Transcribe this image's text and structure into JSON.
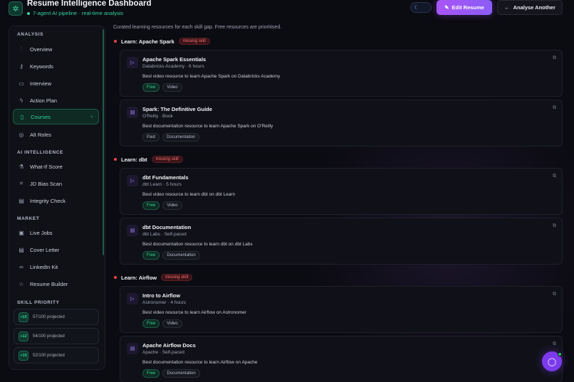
{
  "header": {
    "title": "Resume Intelligence Dashboard",
    "subtitle": "7-agent AI pipeline · real-time analysis",
    "edit_label": "Edit Resume",
    "again_label": "Analyse Another"
  },
  "sidebar": {
    "sections": {
      "analysis": "ANALYSIS",
      "ai": "AI INTELLIGENCE",
      "market": "MARKET",
      "priority": "SKILL PRIORITY"
    },
    "items": [
      {
        "label": "Overview",
        "icon": "bar-chart-icon"
      },
      {
        "label": "Keywords",
        "icon": "key-icon"
      },
      {
        "label": "Interview",
        "icon": "chat-icon"
      },
      {
        "label": "Action Plan",
        "icon": "bolt-icon"
      },
      {
        "label": "Courses",
        "icon": "book-icon",
        "active": true
      },
      {
        "label": "Alt Roles",
        "icon": "target-icon"
      },
      {
        "label": "What-If Score",
        "icon": "flask-icon"
      },
      {
        "label": "JD Bias Scan",
        "icon": "scan-icon"
      },
      {
        "label": "Integrity Check",
        "icon": "document-icon"
      },
      {
        "label": "Live Jobs",
        "icon": "briefcase-icon"
      },
      {
        "label": "Cover Letter",
        "icon": "letter-icon"
      },
      {
        "label": "LinkedIn Kit",
        "icon": "link-icon"
      },
      {
        "label": "Resume Builder",
        "icon": "star-icon"
      }
    ],
    "priority": [
      {
        "badge": "+15",
        "text": "57/100 projected"
      },
      {
        "badge": "+12",
        "text": "54/100 projected"
      },
      {
        "badge": "+10",
        "text": "52/100 projected"
      }
    ]
  },
  "main": {
    "intro": "Curated learning resources for each skill gap. Free resources are prioritised.",
    "missing_label": "missing skill",
    "groups": [
      {
        "label": "Learn: Apache Spark",
        "cards": [
          {
            "title": "Apache Spark Essentials",
            "meta": "Databricks Academy · 6 hours",
            "desc": "Best video resource to learn Apache Spark on Databricks Academy",
            "tags": [
              "Free",
              "Video"
            ],
            "icon": "play-icon"
          },
          {
            "title": "Spark: The Definitive Guide",
            "meta": "O'Reilly · Book",
            "desc": "Best documentation resource to learn Apache Spark on O'Reilly",
            "tags": [
              "Paid",
              "Documentation"
            ],
            "icon": "doc-icon"
          }
        ]
      },
      {
        "label": "Learn: dbt",
        "cards": [
          {
            "title": "dbt Fundamentals",
            "meta": "dbt Learn · 5 hours",
            "desc": "Best video resource to learn dbt on dbt Learn",
            "tags": [
              "Free",
              "Video"
            ],
            "icon": "play-icon"
          },
          {
            "title": "dbt Documentation",
            "meta": "dbt Labs · Self-paced",
            "desc": "Best documentation resource to learn dbt on dbt Labs",
            "tags": [
              "Free",
              "Documentation"
            ],
            "icon": "doc-icon"
          }
        ]
      },
      {
        "label": "Learn: Airflow",
        "cards": [
          {
            "title": "Intro to Airflow",
            "meta": "Astronomer · 4 hours",
            "desc": "Best video resource to learn Airflow on Astronomer",
            "tags": [
              "Free",
              "Video"
            ],
            "icon": "play-icon"
          },
          {
            "title": "Apache Airflow Docs",
            "meta": "Apache · Self-paced",
            "desc": "Best documentation resource to learn Airflow on Apache",
            "tags": [
              "Free",
              "Documentation"
            ],
            "icon": "doc-icon"
          }
        ]
      }
    ]
  },
  "colors": {
    "accent": "#34d399",
    "primary": "#a855f7",
    "danger": "#ef4444",
    "background": "#0b0b12"
  }
}
